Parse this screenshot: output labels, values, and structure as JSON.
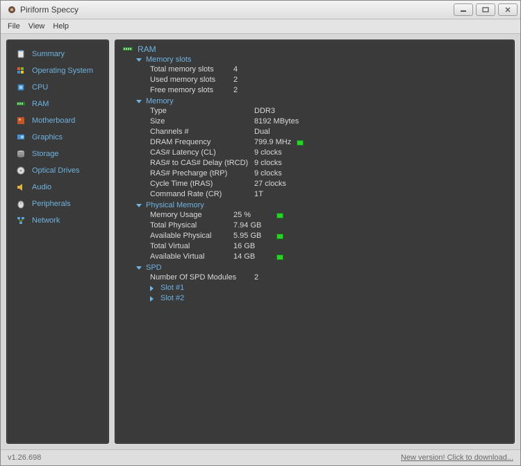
{
  "window": {
    "title": "Piriform Speccy"
  },
  "menu": {
    "file": "File",
    "view": "View",
    "help": "Help"
  },
  "sidebar": {
    "items": [
      {
        "label": "Summary"
      },
      {
        "label": "Operating System"
      },
      {
        "label": "CPU"
      },
      {
        "label": "RAM"
      },
      {
        "label": "Motherboard"
      },
      {
        "label": "Graphics"
      },
      {
        "label": "Storage"
      },
      {
        "label": "Optical Drives"
      },
      {
        "label": "Audio"
      },
      {
        "label": "Peripherals"
      },
      {
        "label": "Network"
      }
    ]
  },
  "content": {
    "heading": "RAM",
    "sections": {
      "memory_slots": {
        "title": "Memory slots",
        "total_label": "Total memory slots",
        "total_value": "4",
        "used_label": "Used memory slots",
        "used_value": "2",
        "free_label": "Free memory slots",
        "free_value": "2"
      },
      "memory": {
        "title": "Memory",
        "type_label": "Type",
        "type_value": "DDR3",
        "size_label": "Size",
        "size_value": "8192 MBytes",
        "channels_label": "Channels #",
        "channels_value": "Dual",
        "dramfreq_label": "DRAM Frequency",
        "dramfreq_value": "799.9 MHz",
        "cas_label": "CAS# Latency (CL)",
        "cas_value": "9 clocks",
        "trcd_label": "RAS# to CAS# Delay (tRCD)",
        "trcd_value": "9 clocks",
        "trp_label": "RAS# Precharge (tRP)",
        "trp_value": "9 clocks",
        "tras_label": "Cycle Time (tRAS)",
        "tras_value": "27 clocks",
        "cr_label": "Command Rate (CR)",
        "cr_value": "1T"
      },
      "physical": {
        "title": "Physical Memory",
        "usage_label": "Memory Usage",
        "usage_value": "25 %",
        "total_label": "Total Physical",
        "total_value": "7.94 GB",
        "avail_label": "Available Physical",
        "avail_value": "5.95 GB",
        "tvirt_label": "Total Virtual",
        "tvirt_value": "16 GB",
        "avirt_label": "Available Virtual",
        "avirt_value": "14 GB"
      },
      "spd": {
        "title": "SPD",
        "count_label": "Number Of SPD Modules",
        "count_value": "2",
        "slot1": "Slot #1",
        "slot2": "Slot #2"
      }
    }
  },
  "status": {
    "version": "v1.26.698",
    "update_link": "New version! Click to download..."
  }
}
